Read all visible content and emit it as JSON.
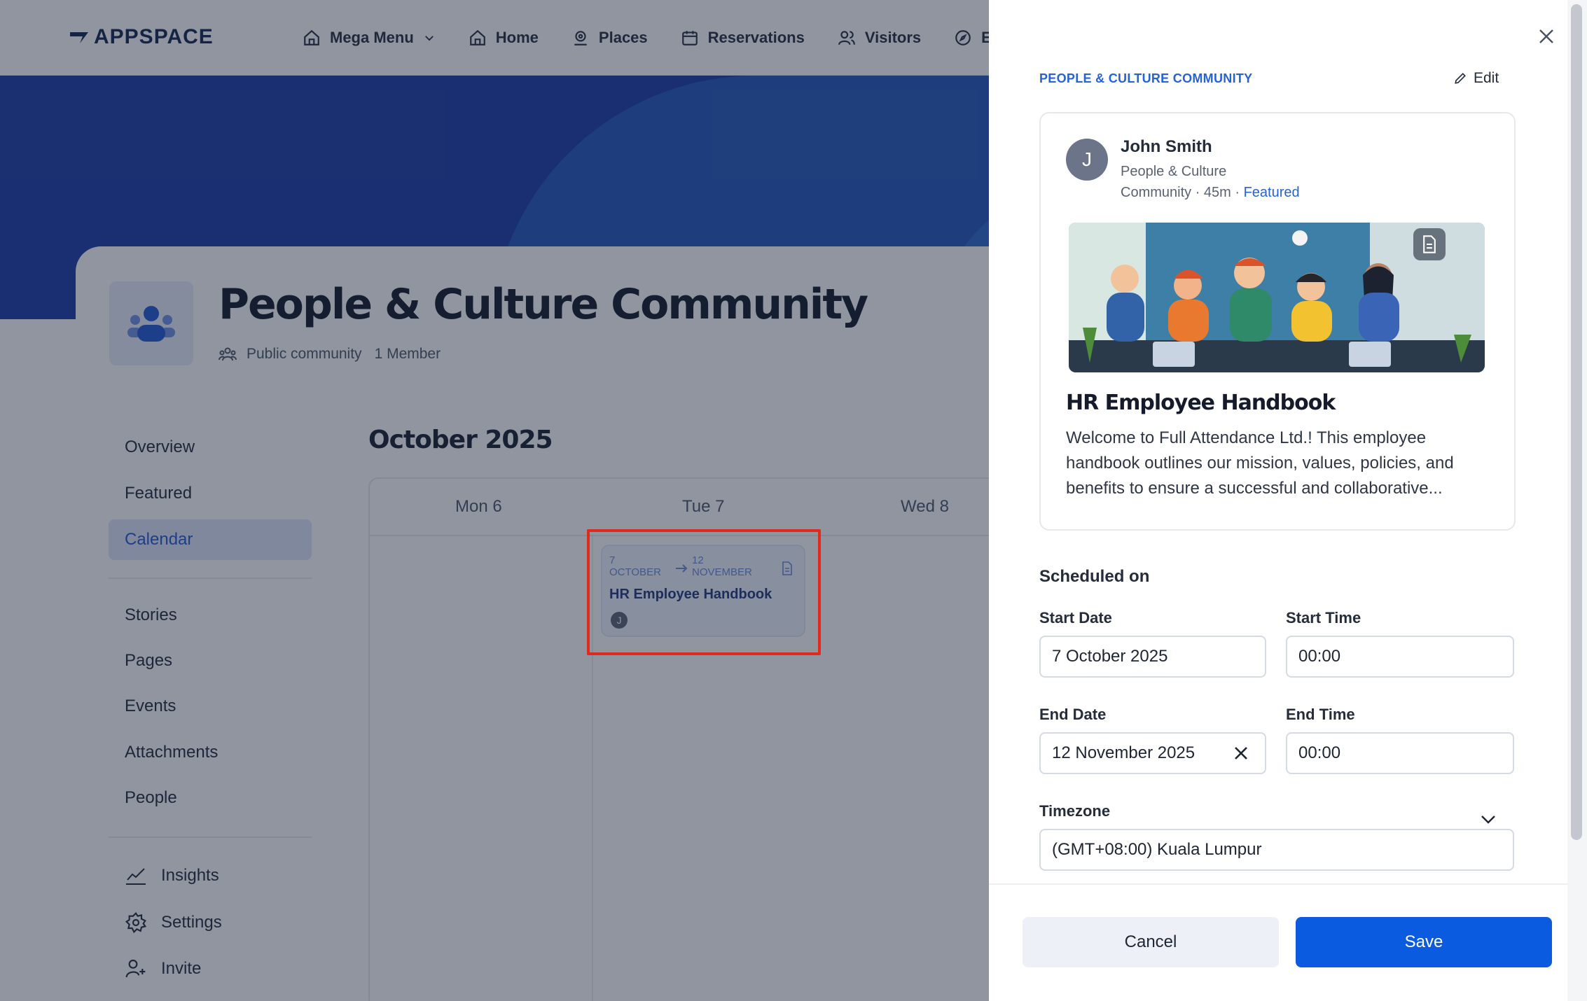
{
  "brand": {
    "name": "APPSPACE"
  },
  "nav": {
    "items": [
      {
        "label": "Mega Menu"
      },
      {
        "label": "Home"
      },
      {
        "label": "Places"
      },
      {
        "label": "Reservations"
      },
      {
        "label": "Visitors"
      },
      {
        "label": "E"
      }
    ]
  },
  "community": {
    "title": "People & Culture Community",
    "type": "Public community",
    "members": "1 Member"
  },
  "sidebar": {
    "items": [
      {
        "label": "Overview"
      },
      {
        "label": "Featured"
      },
      {
        "label": "Calendar"
      },
      {
        "label": "Stories"
      },
      {
        "label": "Pages"
      },
      {
        "label": "Events"
      },
      {
        "label": "Attachments"
      },
      {
        "label": "People"
      },
      {
        "label": "Insights"
      },
      {
        "label": "Settings"
      },
      {
        "label": "Invite"
      }
    ],
    "active": "Calendar"
  },
  "calendar": {
    "month_title": "October 2025",
    "days": [
      "Mon 6",
      "Tue 7",
      "Wed 8"
    ],
    "event": {
      "start_day": "7",
      "start_month": "OCTOBER",
      "end_day": "12",
      "end_month": "NOVEMBER",
      "title": "HR Employee Handbook",
      "avatar_initial": "J"
    }
  },
  "panel": {
    "community_label": "PEOPLE & CULTURE COMMUNITY",
    "edit_label": "Edit",
    "post": {
      "author": "John Smith",
      "avatar_initial": "J",
      "community_line1": "People & Culture",
      "community_line2": "Community · 45m ·",
      "featured_label": "Featured",
      "title": "HR Employee Handbook",
      "excerpt": "Welcome to Full Attendance Ltd.! This employee handbook outlines our mission, values, policies, and benefits to ensure a successful and collaborative..."
    },
    "scheduled_heading": "Scheduled on",
    "start_date_label": "Start Date",
    "start_date_value": "7 October 2025",
    "start_time_label": "Start Time",
    "start_time_value": "00:00",
    "end_date_label": "End Date",
    "end_date_value": "12 November 2025",
    "end_time_label": "End Time",
    "end_time_value": "00:00",
    "timezone_label": "Timezone",
    "timezone_value": "(GMT+08:00) Kuala Lumpur",
    "cancel_label": "Cancel",
    "save_label": "Save"
  },
  "colors": {
    "primary": "#0b5be0",
    "link": "#2563d6",
    "hero": "#1b3ca5",
    "highlight": "#e22a1a"
  }
}
